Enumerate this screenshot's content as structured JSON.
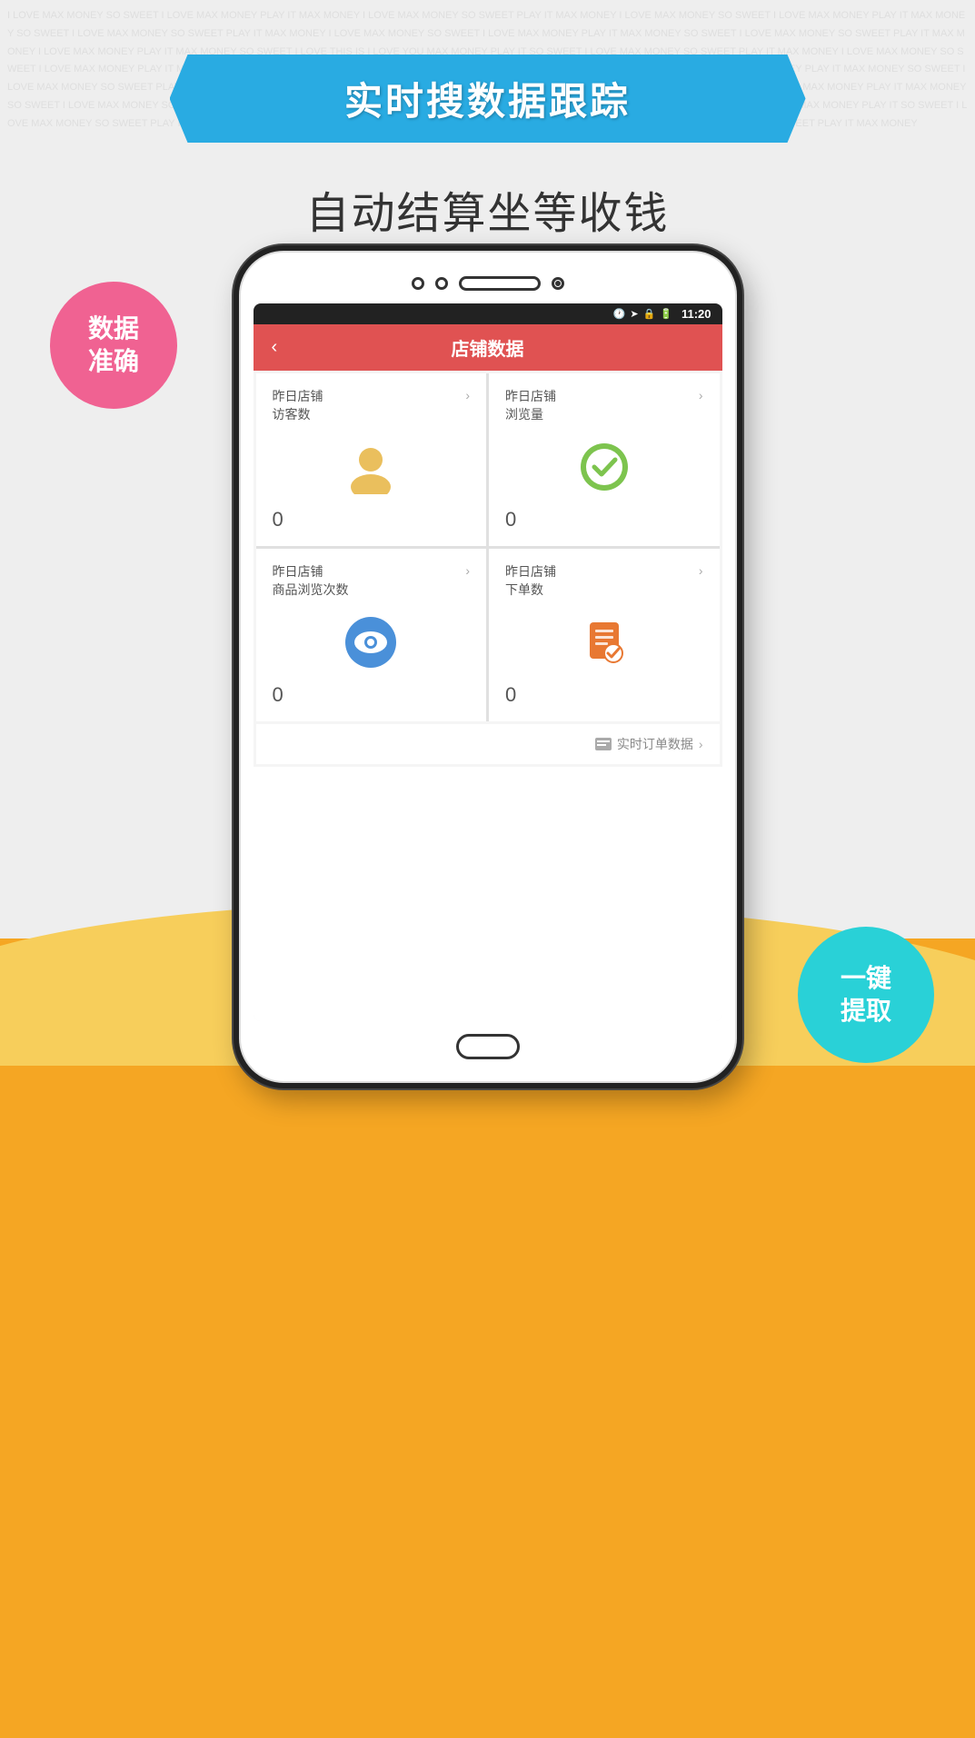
{
  "banner": {
    "text": "实时搜数据跟踪"
  },
  "subtitle": {
    "text": "自动结算坐等收钱"
  },
  "pink_bubble": {
    "line1": "数据",
    "line2": "准确"
  },
  "cyan_bubble": {
    "line1": "一键",
    "line2": "提取"
  },
  "phone": {
    "status_bar": {
      "time": "11:20",
      "icons": [
        "🕐",
        "➤",
        "🔒",
        "🔋"
      ]
    },
    "header": {
      "back": "‹",
      "title": "店铺数据"
    },
    "cards": [
      {
        "title_line1": "昨日店铺",
        "title_line2": "访客数",
        "icon": "user",
        "value": "0"
      },
      {
        "title_line1": "昨日店铺",
        "title_line2": "浏览量",
        "icon": "circle-check",
        "value": "0"
      },
      {
        "title_line1": "昨日店铺",
        "title_line2": "商品浏览次数",
        "icon": "eye",
        "value": "0"
      },
      {
        "title_line1": "昨日店铺",
        "title_line2": "下单数",
        "icon": "order",
        "value": "0"
      }
    ],
    "realtime_link": {
      "text": "实时订单数据",
      "arrow": "›"
    }
  },
  "colors": {
    "banner_blue": "#29ABE2",
    "header_red": "#E05252",
    "pink_bubble": "#F06292",
    "cyan_bubble": "#29D1D7",
    "orange_bg": "#F5A623",
    "yellow_wave": "#F7CE5B",
    "icon_user": "#E8B84B",
    "icon_browse": "#7DC44E",
    "icon_eye": "#4A90D9",
    "icon_order": "#E87832"
  }
}
